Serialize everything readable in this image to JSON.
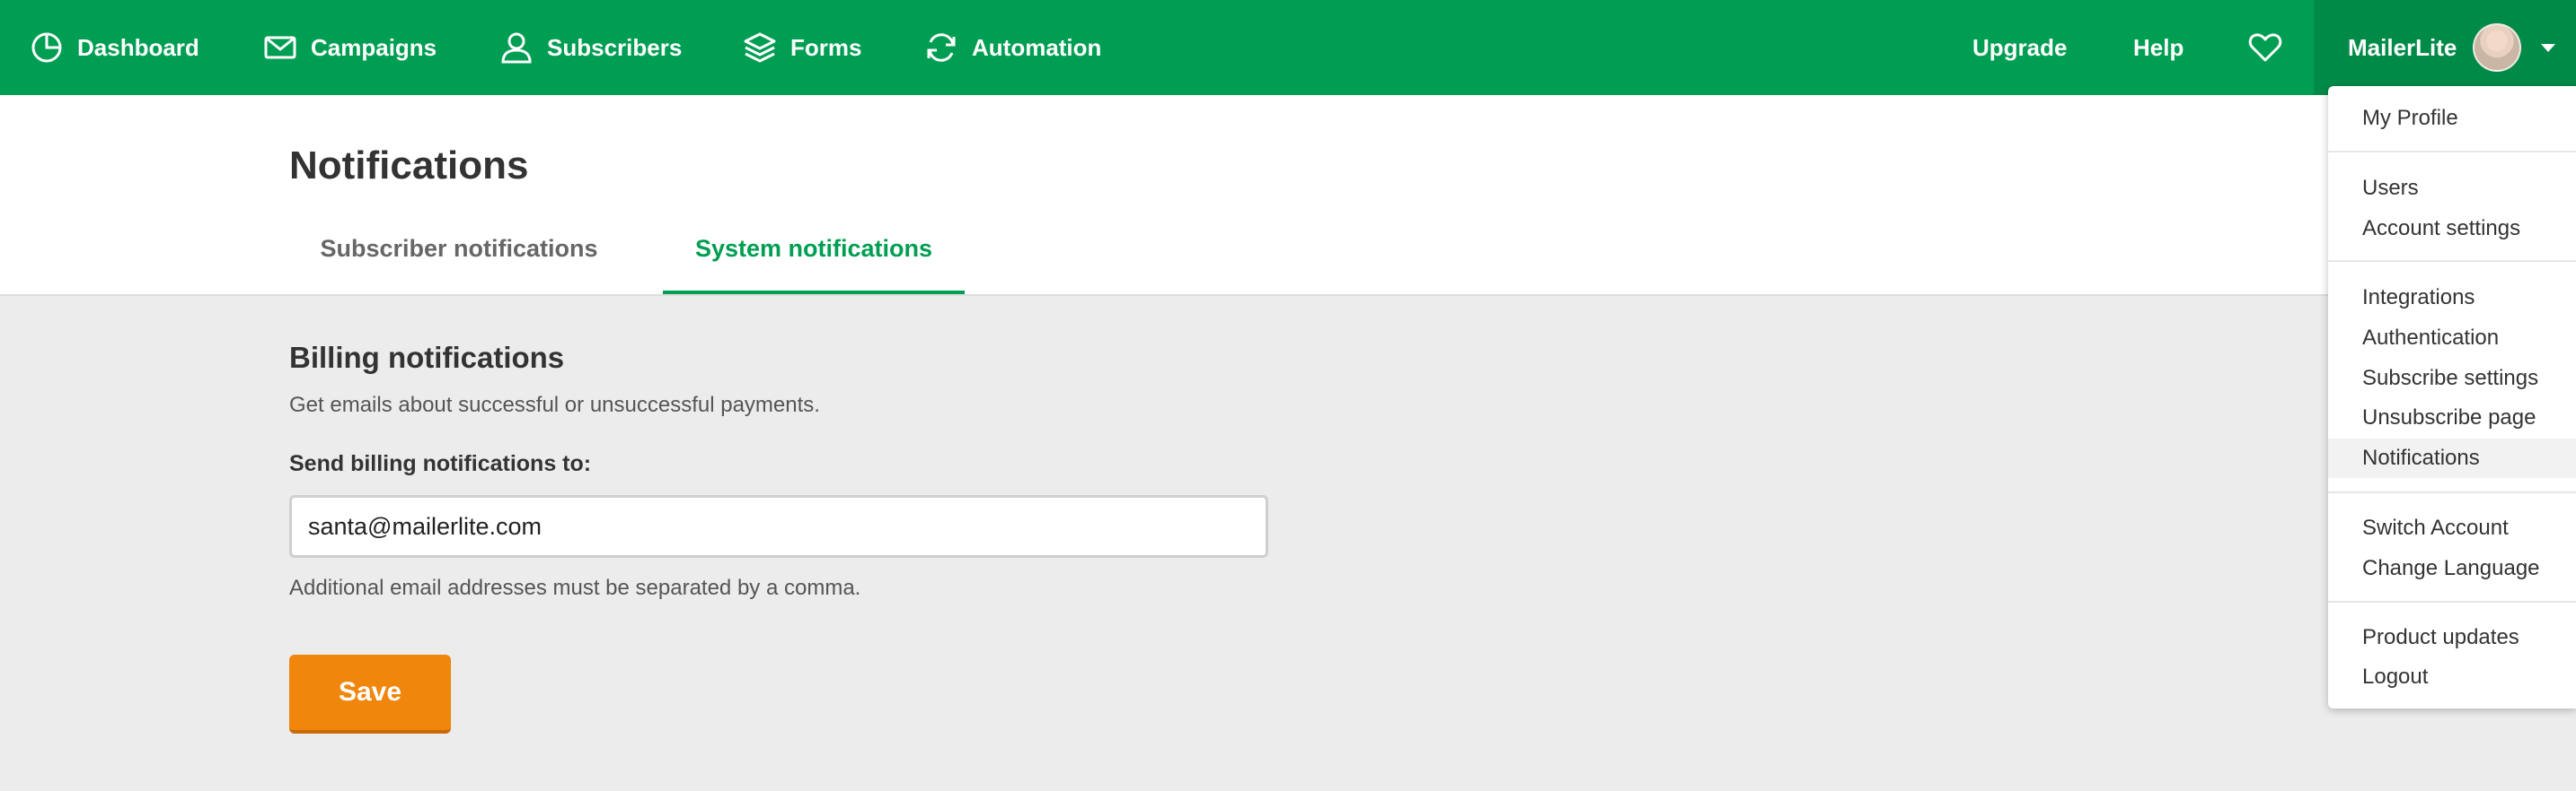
{
  "nav": {
    "items": [
      {
        "label": "Dashboard",
        "icon": "dashboard-icon"
      },
      {
        "label": "Campaigns",
        "icon": "envelope-icon"
      },
      {
        "label": "Subscribers",
        "icon": "user-icon"
      },
      {
        "label": "Forms",
        "icon": "layers-icon"
      },
      {
        "label": "Automation",
        "icon": "refresh-icon"
      }
    ],
    "upgrade": "Upgrade",
    "help": "Help",
    "account_name": "MailerLite"
  },
  "page": {
    "title": "Notifications",
    "tabs": [
      {
        "label": "Subscriber notifications",
        "active": false
      },
      {
        "label": "System notifications",
        "active": true
      }
    ]
  },
  "billing": {
    "title": "Billing notifications",
    "description": "Get emails about successful or unsuccessful payments.",
    "field_label": "Send billing notifications to:",
    "email_value": "santa@mailerlite.com",
    "hint": "Additional email addresses must be separated by a comma.",
    "save_label": "Save"
  },
  "dropdown": {
    "items": [
      "My Profile",
      "Users",
      "Account settings",
      "Integrations",
      "Authentication",
      "Subscribe settings",
      "Unsubscribe page",
      "Notifications",
      "Switch Account",
      "Change Language",
      "Product updates",
      "Logout"
    ],
    "highlighted": "Notifications"
  },
  "colors": {
    "brand_green": "#009e52",
    "save_orange": "#f0860c",
    "background": "#ececec"
  }
}
